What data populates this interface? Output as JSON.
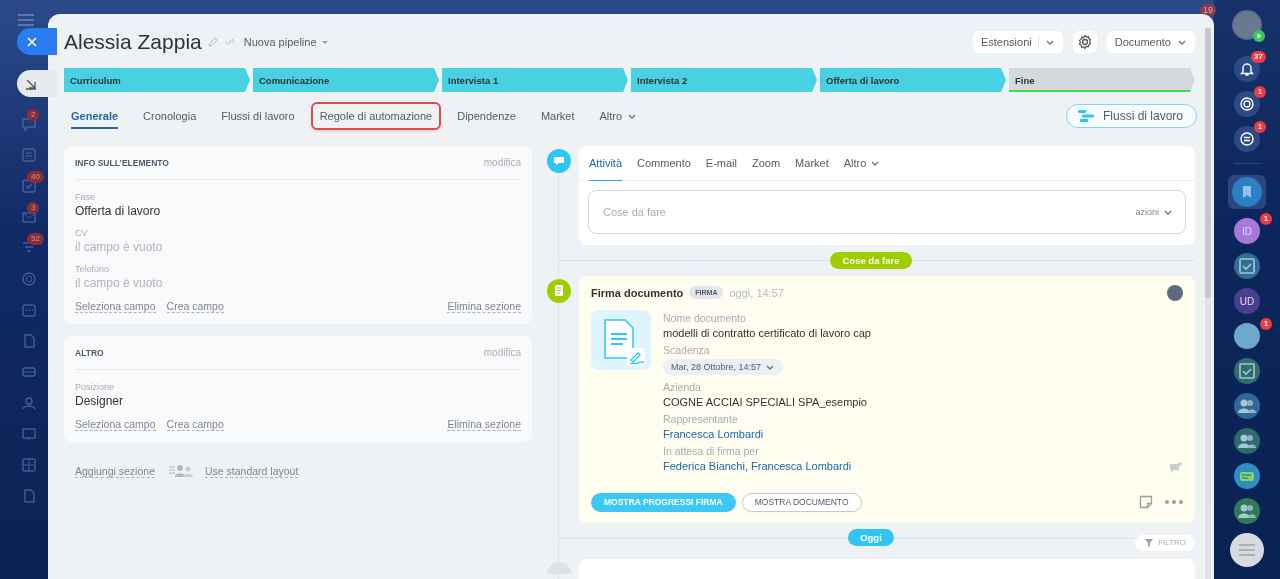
{
  "topbar": {
    "badge": "19"
  },
  "left_rail": [
    {
      "kind": "chat",
      "badge": "2"
    },
    {
      "kind": "list"
    },
    {
      "kind": "check",
      "badge": "40"
    },
    {
      "kind": "mail",
      "badge": "3"
    },
    {
      "kind": "filter",
      "badge": "52"
    },
    {
      "kind": "circle"
    },
    {
      "kind": "calendar"
    },
    {
      "kind": "doc"
    },
    {
      "kind": "card"
    },
    {
      "kind": "users"
    },
    {
      "kind": "board"
    },
    {
      "kind": "grid"
    },
    {
      "kind": "doc"
    }
  ],
  "header": {
    "title": "Alessia Zappia",
    "pipeline": "Nuova pipeline",
    "extensions": "Estensioni",
    "document": "Documento"
  },
  "stages": [
    {
      "label": "Curriculum",
      "kind": "step",
      "color": "#47d1e2"
    },
    {
      "label": "Comunicazione",
      "kind": "step",
      "color": "#47d1e2"
    },
    {
      "label": "Intervista 1",
      "kind": "step",
      "color": "#47d1e2"
    },
    {
      "label": "Intervista 2",
      "kind": "step",
      "color": "#47d1e2"
    },
    {
      "label": "Offerta di lavoro",
      "kind": "step",
      "color": "#47d1e2"
    },
    {
      "label": "Fine",
      "kind": "final",
      "color": "#d5d8dc"
    }
  ],
  "tabs": [
    {
      "label": "Generale",
      "selected": true,
      "highlighted": false,
      "menu": false
    },
    {
      "label": "Cronologia",
      "selected": false,
      "highlighted": false,
      "menu": false
    },
    {
      "label": "Flussi di lavoro",
      "selected": false,
      "highlighted": false,
      "menu": false
    },
    {
      "label": "Regole di automazione",
      "selected": false,
      "highlighted": true,
      "menu": false
    },
    {
      "label": "Dipendenze",
      "selected": false,
      "highlighted": false,
      "menu": false
    },
    {
      "label": "Market",
      "selected": false,
      "highlighted": false,
      "menu": false
    },
    {
      "label": "Altro",
      "selected": false,
      "highlighted": false,
      "menu": true
    }
  ],
  "workflow_button": "Flussi di lavoro",
  "sections": [
    {
      "title": "INFO SULL'ELEMENTO",
      "action": "modifica",
      "fields": [
        {
          "label": "Fase",
          "value": "Offerta di lavoro",
          "empty": false
        },
        {
          "label": "CV",
          "value": "il campo è vuoto",
          "empty": true
        },
        {
          "label": "Telefono",
          "value": "il campo è vuoto",
          "empty": true
        }
      ],
      "links": [
        "Seleziona campo",
        "Crea campo"
      ],
      "delete": "Elimina sezione"
    },
    {
      "title": "ALTRO",
      "action": "modifica",
      "fields": [
        {
          "label": "Posizione",
          "value": "Designer",
          "empty": false
        }
      ],
      "links": [
        "Seleziona campo",
        "Crea campo"
      ],
      "delete": "Elimina sezione"
    }
  ],
  "section_footer": {
    "add": "Aggiungi sezione",
    "layout": "Use standard layout"
  },
  "activity": {
    "tabs": [
      {
        "label": "Attività",
        "selected": true,
        "menu": false
      },
      {
        "label": "Commento",
        "selected": false,
        "menu": false
      },
      {
        "label": "E-mail",
        "selected": false,
        "menu": false
      },
      {
        "label": "Zoom",
        "selected": false,
        "menu": false
      },
      {
        "label": "Market",
        "selected": false,
        "menu": false
      },
      {
        "label": "Altro",
        "selected": false,
        "menu": true
      }
    ],
    "placeholder": "Cose da fare",
    "actions": "azioni"
  },
  "todo_marker": "Cose da fare",
  "document_card": {
    "title": "Firma documento",
    "tag": "FIRMA",
    "time": "oggi, 14:57",
    "fields": [
      {
        "label": "Nome documento",
        "value": "modelli di contratto certificato di lavoro cap",
        "kind": "text"
      },
      {
        "label": "Scadenza",
        "value": "Mar, 28 Ottobre, 14:57",
        "kind": "date"
      },
      {
        "label": "Azienda",
        "value": "COGNE ACCIAI SPECIALI SPA_esempio",
        "kind": "text"
      },
      {
        "label": "Rappresentante",
        "value": "Francesca Lombardi",
        "kind": "link"
      },
      {
        "label": "In attesa di firma per",
        "value": "Federica Bianchi, Francesca Lombardi",
        "kind": "link"
      }
    ],
    "buttons": [
      {
        "label": "MOSTRA PROGRESSI FIRMA",
        "primary": true
      },
      {
        "label": "MOSTRA DOCUMENTO",
        "primary": false
      }
    ]
  },
  "today_marker": "Oggi",
  "filter": "FILTRO",
  "right_rail": [
    {
      "kind": "bell",
      "badge": "37"
    },
    {
      "kind": "target",
      "badge": "1"
    },
    {
      "kind": "swap",
      "badge": "1"
    },
    {
      "kind": "bookmark",
      "selected": true
    },
    {
      "kind": "initials",
      "text": "ID",
      "color": "#a678d8",
      "badge": "1"
    },
    {
      "kind": "task",
      "color": "#2f6f96"
    },
    {
      "kind": "initials",
      "text": "UD",
      "color": "#4a3f8f"
    },
    {
      "kind": "avatar",
      "color": "#6fa9c9",
      "badge": "1"
    },
    {
      "kind": "task",
      "color": "#2f6e6e"
    },
    {
      "kind": "group",
      "color": "#2f6796"
    },
    {
      "kind": "group",
      "color": "#2f6b6b"
    },
    {
      "kind": "chat",
      "color": "#2d8ec0"
    },
    {
      "kind": "group",
      "color": "#2f7a55"
    }
  ]
}
